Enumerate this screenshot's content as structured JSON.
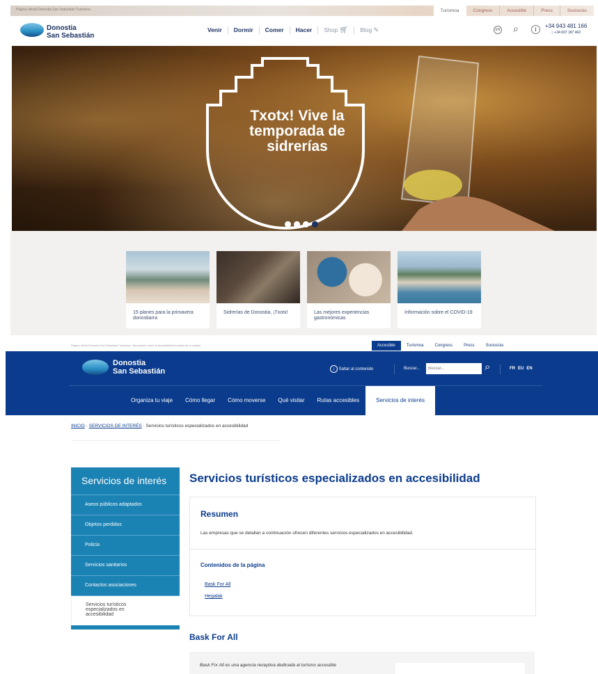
{
  "site1": {
    "official_text": "Página oficial Donostia San Sebastián Turismoa",
    "top_tabs": [
      "Turismoa",
      "Congress",
      "Accesible",
      "Press",
      "Socios/as"
    ],
    "logo_line1": "Donostia",
    "logo_line2": "San Sebastián",
    "nav": [
      "Venir",
      "Dormir",
      "Comer",
      "Hacer",
      "Shop",
      "Blog"
    ],
    "lang_badge": "EN",
    "phone_main": "+34 943 481 166",
    "phone_whatsapp": "+34 607 187 462",
    "hero_title_l1": "Txotx! Vive la",
    "hero_title_l2": "temporada de",
    "hero_title_l3": "sidrerías",
    "cards": [
      {
        "caption": "15 planes para la primavera donostiarra"
      },
      {
        "caption": "Sidrerías de Donostia, ¡Txotx!"
      },
      {
        "caption": "Las mejores experiencias gastronómicas"
      },
      {
        "caption": "Información sobre el COVID-19"
      }
    ]
  },
  "site2": {
    "official_text": "Página oficial Donostia San Sebastián Turismoa. Información sobre la accesibilidad turística de la ciudad.",
    "top_tabs": [
      "Accesible",
      "Turismoa",
      "Congress",
      "Press",
      "Socios/as"
    ],
    "logo_line1": "Donostia",
    "logo_line2": "San Sebastián",
    "skip_label": "Saltar al contenido",
    "search_label": "Buscar...",
    "search_placeholder": "Buscar...",
    "langs": [
      "FR",
      "EU",
      "EN"
    ],
    "nav": [
      "Organiza tu viaje",
      "Cómo llegar",
      "Cómo moverse",
      "Qué visitar",
      "Rutas accesibles",
      "Servicios de interés"
    ],
    "breadcrumb": {
      "home": "INICIO",
      "section": "SERVICIOS DE INTERÉS",
      "current": "Servicios turísticos especializados en accesibilidad"
    },
    "sidebar_title": "Servicios de interés",
    "sidebar_items": [
      "Aseos públicos adaptados",
      "Objetos perdidos",
      "Policía",
      "Servicios sanitarios",
      "Contactos asociaciones"
    ],
    "sidebar_active_l1": "Servicios turísticos",
    "sidebar_active_l2": "especializados en",
    "sidebar_active_l3": "accesibilidad",
    "page_title": "Servicios turísticos especializados en accesibilidad",
    "summary_heading": "Resumen",
    "summary_text": "Las empresas que se detallan a continuación ofrecen diferentes servicios especializados en accesibilidad.",
    "contents_heading": "Contenidos de la página",
    "contents_links": [
      "Bask For All",
      "Hegalak"
    ],
    "section_heading": "Bask For All",
    "section_text": "Bask For All es una agencia receptiva dedicada al turismo accesible"
  },
  "colors": {
    "navy": "#0b3b8c",
    "teal": "#1b82b4",
    "accent_red": "#a26157"
  }
}
